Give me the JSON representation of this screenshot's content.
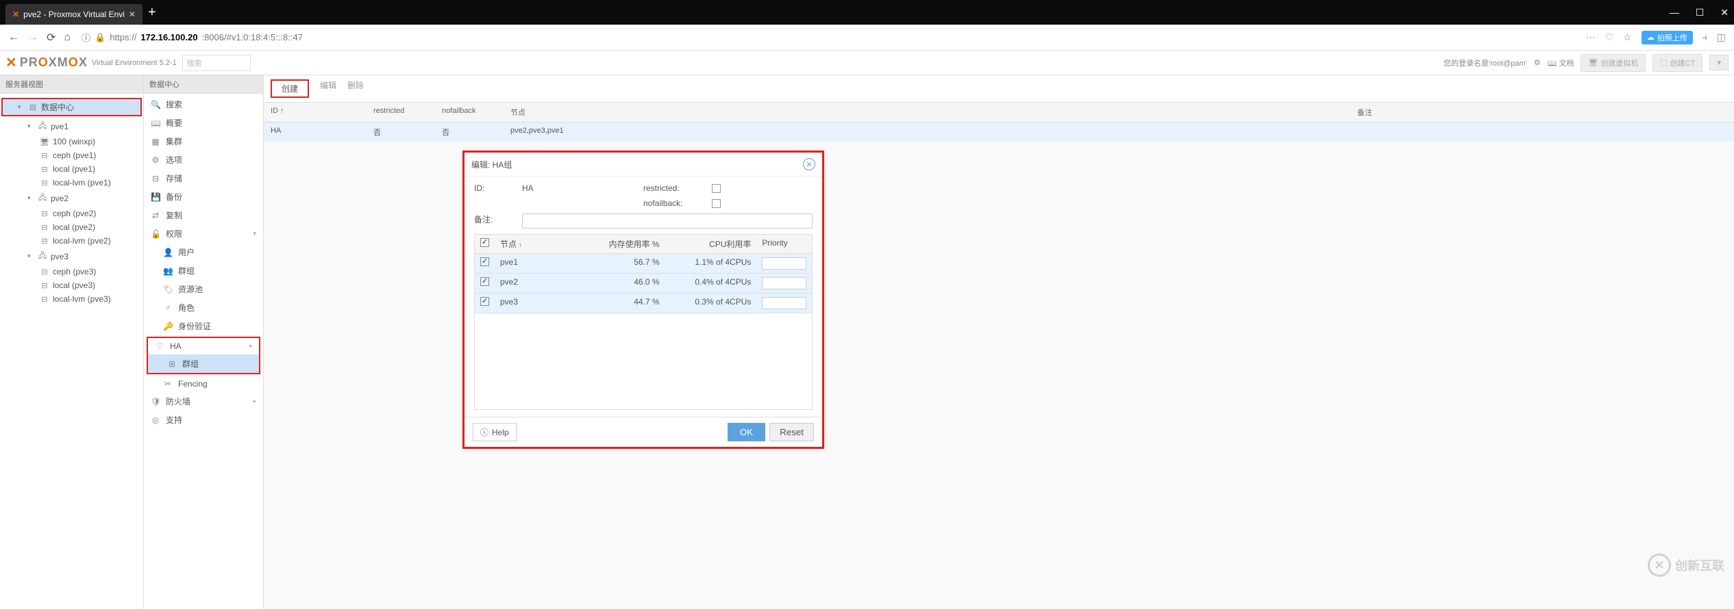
{
  "browser": {
    "tab_title": "pve2 - Proxmox Virtual Envi",
    "url_protocol": "https://",
    "url_host": "172.16.100.20",
    "url_path": ":8006/#v1:0:18:4:5:::8::47"
  },
  "ext_badge": "拍照上传",
  "header": {
    "version": "Virtual Environment 5.2-1",
    "search_placeholder": "搜索",
    "login_info": "您的登录名是'root@pam'",
    "btn_docs": "文档",
    "btn_create_vm": "创建虚拟机",
    "btn_create_ct": "创建CT"
  },
  "left_panel_title": "服务器视图",
  "tree": {
    "datacenter": "数据中心",
    "nodes": [
      {
        "name": "pve1",
        "children": [
          "100 (winxp)",
          "ceph (pve1)",
          "local (pve1)",
          "local-lvm (pve1)"
        ]
      },
      {
        "name": "pve2",
        "children": [
          "ceph (pve2)",
          "local (pve2)",
          "local-lvm (pve2)"
        ]
      },
      {
        "name": "pve3",
        "children": [
          "ceph (pve3)",
          "local (pve3)",
          "local-lvm (pve3)"
        ]
      }
    ]
  },
  "mid_panel_title": "数据中心",
  "mid_nav": {
    "search": "搜索",
    "summary": "概要",
    "cluster": "集群",
    "options": "选项",
    "storage": "存储",
    "backup": "备份",
    "replication": "复制",
    "permissions": "权限",
    "users": "用户",
    "groups": "群组",
    "pools": "资源池",
    "roles": "角色",
    "auth": "身份验证",
    "ha": "HA",
    "ha_groups": "群组",
    "fencing": "Fencing",
    "firewall": "防火墙",
    "support": "支持"
  },
  "toolbar": {
    "create": "创建",
    "edit": "编辑",
    "delete": "删除"
  },
  "table_headers": {
    "id": "ID ↑",
    "restricted": "restricted",
    "nofailback": "nofailback",
    "nodes": "节点",
    "comment": "备注"
  },
  "table_row": {
    "id": "HA",
    "restricted": "否",
    "nofailback": "否",
    "nodes": "pve2,pve3,pve1",
    "comment": ""
  },
  "dialog": {
    "title": "编辑: HA组",
    "id_label": "ID:",
    "id_value": "HA",
    "restricted_label": "restricted:",
    "nofailback_label": "nofailback:",
    "comment_label": "备注:",
    "grid_headers": {
      "node": "节点",
      "mem": "内存使用率 %",
      "cpu": "CPU利用率",
      "priority": "Priority"
    },
    "rows": [
      {
        "node": "pve1",
        "mem": "56.7 %",
        "cpu": "1.1% of 4CPUs"
      },
      {
        "node": "pve2",
        "mem": "46.0 %",
        "cpu": "0.4% of 4CPUs"
      },
      {
        "node": "pve3",
        "mem": "44.7 %",
        "cpu": "0.3% of 4CPUs"
      }
    ],
    "help": "Help",
    "ok": "OK",
    "reset": "Reset"
  },
  "watermark": "创新互联"
}
